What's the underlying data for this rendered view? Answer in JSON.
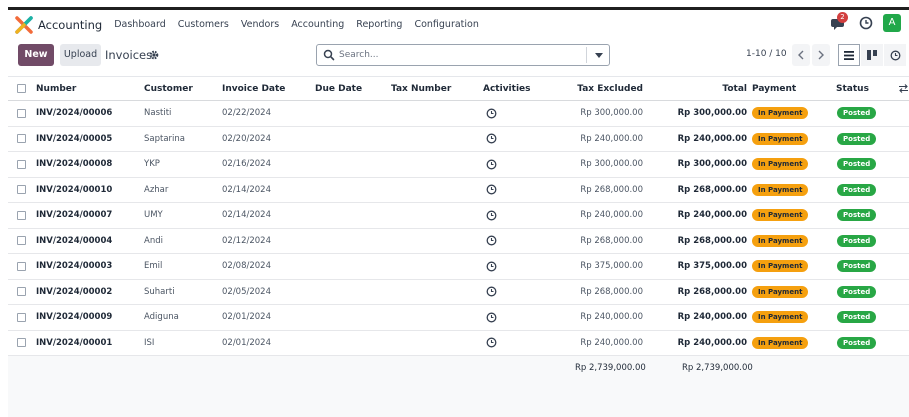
{
  "navbar": {
    "app_name": "Accounting",
    "menu": [
      "Dashboard",
      "Customers",
      "Vendors",
      "Accounting",
      "Reporting",
      "Configuration"
    ],
    "chat_badge": "2",
    "avatar_letter": "A",
    "avatar_color": "#21a84a"
  },
  "control": {
    "new_label": "New",
    "upload_label": "Upload",
    "breadcrumb": "Invoices",
    "search_placeholder": "Search...",
    "pager": "1-10 / 10",
    "prev_icon": "chevron-left-icon",
    "next_icon": "chevron-right-icon"
  },
  "columns": [
    "Number",
    "Customer",
    "Invoice Date",
    "Due Date",
    "Tax Number",
    "Activities",
    "Tax Excluded",
    "Total",
    "Payment",
    "Status"
  ],
  "rows": [
    {
      "number": "INV/2024/00006",
      "customer": "Nastiti",
      "date": "02/22/2024",
      "tax_excl": "Rp 300,000.00",
      "total": "Rp 300,000.00",
      "payment": "In Payment",
      "status": "Posted"
    },
    {
      "number": "INV/2024/00005",
      "customer": "Saptarina",
      "date": "02/20/2024",
      "tax_excl": "Rp 240,000.00",
      "total": "Rp 240,000.00",
      "payment": "In Payment",
      "status": "Posted"
    },
    {
      "number": "INV/2024/00008",
      "customer": "YKP",
      "date": "02/16/2024",
      "tax_excl": "Rp 300,000.00",
      "total": "Rp 300,000.00",
      "payment": "In Payment",
      "status": "Posted"
    },
    {
      "number": "INV/2024/00010",
      "customer": "Azhar",
      "date": "02/14/2024",
      "tax_excl": "Rp 268,000.00",
      "total": "Rp 268,000.00",
      "payment": "In Payment",
      "status": "Posted"
    },
    {
      "number": "INV/2024/00007",
      "customer": "UMY",
      "date": "02/14/2024",
      "tax_excl": "Rp 240,000.00",
      "total": "Rp 240,000.00",
      "payment": "In Payment",
      "status": "Posted"
    },
    {
      "number": "INV/2024/00004",
      "customer": "Andi",
      "date": "02/12/2024",
      "tax_excl": "Rp 268,000.00",
      "total": "Rp 268,000.00",
      "payment": "In Payment",
      "status": "Posted"
    },
    {
      "number": "INV/2024/00003",
      "customer": "Emil",
      "date": "02/08/2024",
      "tax_excl": "Rp 375,000.00",
      "total": "Rp 375,000.00",
      "payment": "In Payment",
      "status": "Posted"
    },
    {
      "number": "INV/2024/00002",
      "customer": "Suharti",
      "date": "02/05/2024",
      "tax_excl": "Rp 268,000.00",
      "total": "Rp 268,000.00",
      "payment": "In Payment",
      "status": "Posted"
    },
    {
      "number": "INV/2024/00009",
      "customer": "Adiguna",
      "date": "02/01/2024",
      "tax_excl": "Rp 240,000.00",
      "total": "Rp 240,000.00",
      "payment": "In Payment",
      "status": "Posted"
    },
    {
      "number": "INV/2024/00001",
      "customer": "ISI",
      "date": "02/01/2024",
      "tax_excl": "Rp 240,000.00",
      "total": "Rp 240,000.00",
      "payment": "In Payment",
      "status": "Posted"
    }
  ],
  "footer": {
    "sum_tax_excluded": "Rp 2,739,000.00",
    "sum_total": "Rp 2,739,000.00"
  },
  "colors": {
    "brand": "#714b67",
    "payment_badge": "#f5a00f",
    "posted_badge": "#28a745"
  }
}
